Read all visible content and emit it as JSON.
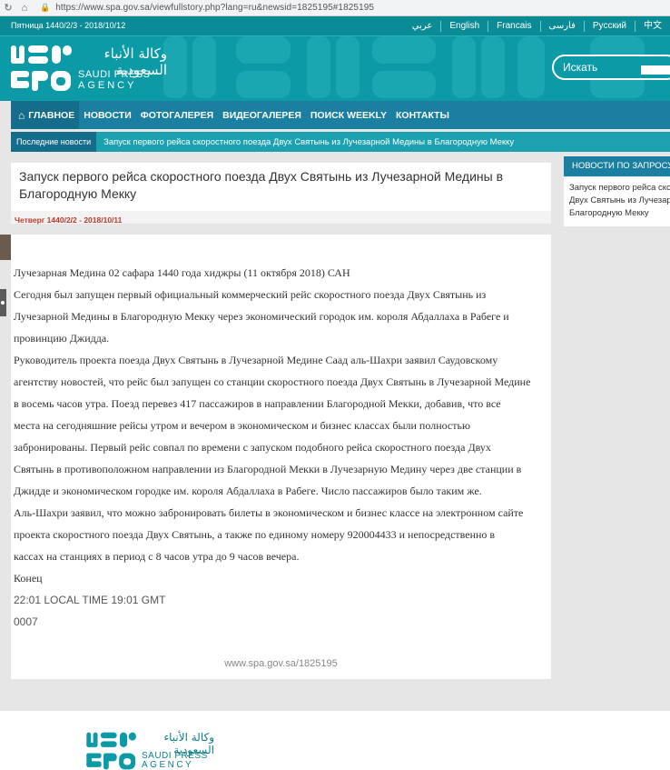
{
  "browser": {
    "url": "https://www.spa.gov.sa/viewfullstory.php?lang=ru&newsid=1825195#1825195"
  },
  "header": {
    "date": "Пятница 1440/2/3 - 2018/10/12",
    "languages": [
      "عربي",
      "English",
      "Francais",
      "فارسی",
      "Русский",
      "中文"
    ],
    "logo": {
      "arabic": "وكالة الأنباء السعودية",
      "en_line1": "SAUDI PRESS",
      "en_line2": "AGENCY"
    },
    "search_placeholder": "Искать"
  },
  "nav": {
    "items": [
      "ГЛАВНОЕ",
      "НОВОСТИ",
      "ФОТОГАЛЕРЕЯ",
      "ВИДЕОГАЛЕРЕЯ",
      "ПОИСК WEEKLY",
      "КОНТАКТЫ"
    ]
  },
  "ticker": {
    "label": "Последние новости",
    "text": "Запуск первого рейса скоростного поезда Двух Святынь из Лучезарной Медины в Благородную Мекку"
  },
  "article": {
    "title": "Запуск первого рейса скоростного поезда Двух Святынь из Лучезарной Медины в Благородную Мекку",
    "date": "Четверг 1440/2/2 - 2018/10/11",
    "lines": [
      "Лучезарная Медина 02 сафара 1440 года хиджры (11 октября 2018) САН",
      "Сегодня был запущен первый официальный коммерческий рейс скоростного поезда Двух Святынь из",
      "Лучезарной Медины в Благородную Мекку через экономический городок им. короля Абдаллаха в Рабеге и",
      "провинцию Джидда.",
      "Руководитель проекта поезда Двух Святынь в Лучезарной Медине Саад аль-Шахри заявил Саудовскому",
      "агентству новостей, что рейс был запущен со станции скоростного поезда Двух Святынь в Лучезарной Медине",
      "в восемь часов утра. Поезд перевез 417 пассажиров в направлении Благородной Мекки, добавив, что все",
      "места на сегодняшние рейсы утром и вечером в экономическом и бизнес классах были полностью",
      "забронированы. Первый рейс совпал по времени с запуском подобного рейса скоростного поезда Двух",
      "Святынь в противоположном направлении из Благородной Мекки в Лучезарную Медину через две станции в",
      "Джидде и экономическом городке им. короля Абдаллаха в Рабеге. Число пассажиров было таким же.",
      "Аль-Шахри заявил, что можно забронировать билеты в экономическом и бизнес классе на электронном сайте",
      "проекта скоростного поезда Двух Святынь, а также по единому номеру 920004433 и непосредственно в",
      "кассах на станциях в период с 8 часов утра до 9 часов вечера."
    ],
    "end_label": "Конец",
    "time": "22:01 LOCAL TIME 19:01 GMT",
    "code": "0007",
    "short_url": "www.spa.gov.sa/1825195"
  },
  "related": {
    "heading": "НОВОСТИ ПО ЗАПРОСУ",
    "lines": [
      "Запуск первого рейса скоростного поезда",
      "Двух Святынь из Лучезарной Медины в",
      "Благородную Мекку"
    ]
  },
  "footer": {
    "logo": {
      "arabic": "وكالة الأنباء السعودية",
      "en_line1": "SAUDI PRESS",
      "en_line2": "AGENCY"
    }
  },
  "colors": {
    "teal": "#0c9aa6",
    "nav_blue": "#1a7fa0",
    "ticker_teal": "#1ca1b0",
    "date_red": "#c0392b"
  }
}
